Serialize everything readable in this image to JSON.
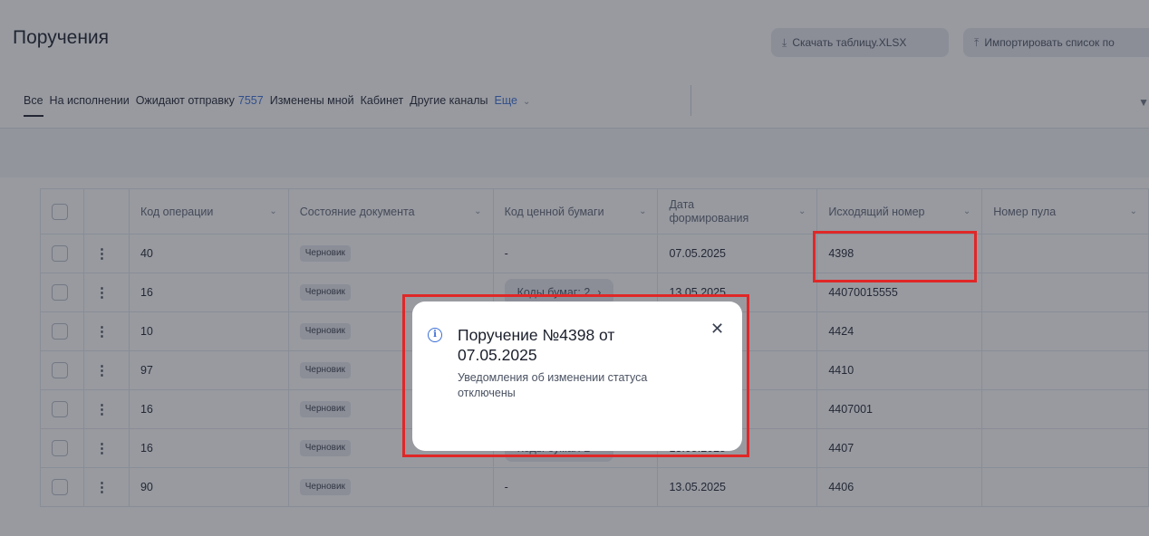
{
  "page": {
    "title": "Поручения",
    "download_label": "Скачать таблицу.XLSX",
    "import_label": "Импортировать список по"
  },
  "tabs": [
    {
      "label": "Все"
    },
    {
      "label": "На исполнении"
    },
    {
      "label": "Ожидают отправку",
      "count": "7557"
    },
    {
      "label": "Изменены мной"
    },
    {
      "label": "Кабинет"
    },
    {
      "label": "Другие каналы"
    }
  ],
  "tabs_more": "Еще",
  "table": {
    "columns": [
      "Код операции",
      "Состояние документа",
      "Код ценной бумаги",
      "Дата формирования",
      "Исходящий номер",
      "Номер пула"
    ],
    "rows": [
      {
        "op": "40",
        "state": "Черновик",
        "sec": "-",
        "date": "07.05.2025",
        "out": "4398"
      },
      {
        "op": "16",
        "state": "Черновик",
        "sec": "Коды бумаг: 2",
        "date": "13.05.2025",
        "out": "44070015555"
      },
      {
        "op": "10",
        "state": "Черновик",
        "sec": "",
        "date": "",
        "out": "4424"
      },
      {
        "op": "97",
        "state": "Черновик",
        "sec": "",
        "date": "",
        "out": "4410"
      },
      {
        "op": "16",
        "state": "Черновик",
        "sec": "",
        "date": "",
        "out": "4407001"
      },
      {
        "op": "16",
        "state": "Черновик",
        "sec": "Коды бумаг: 2",
        "date": "13.05.2025",
        "out": "4407"
      },
      {
        "op": "90",
        "state": "Черновик",
        "sec": "-",
        "date": "13.05.2025",
        "out": "4406"
      }
    ]
  },
  "toast": {
    "title": "Поручение №4398 от 07.05.2025",
    "message": "Уведомления об изменении статуса отключены"
  },
  "colors": {
    "accent": "#3b6fd6",
    "highlight": "#e02727"
  }
}
